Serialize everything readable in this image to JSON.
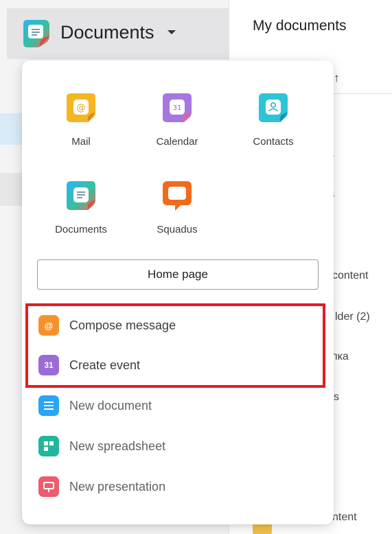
{
  "app_switcher": {
    "title": "Documents",
    "caret_icon": "chevron-down-icon",
    "icon": "documents-icon"
  },
  "main": {
    "title": "My documents",
    "sort_icon": "arrow-up-icon",
    "list_fragments": [
      "gh",
      "-",
      "ats",
      "content",
      "lder (2)",
      "апка",
      "s",
      "l",
      "ntent"
    ]
  },
  "menu": {
    "apps": [
      {
        "label": "Mail",
        "icon": "mail-icon"
      },
      {
        "label": "Calendar",
        "icon": "calendar-icon"
      },
      {
        "label": "Contacts",
        "icon": "contacts-icon"
      },
      {
        "label": "Documents",
        "icon": "documents-icon"
      },
      {
        "label": "Squadus",
        "icon": "squadus-icon"
      }
    ],
    "home_button": "Home page",
    "actions": [
      {
        "label": "Compose message",
        "icon": "at-icon",
        "glyph": "@",
        "color": "#f6922b"
      },
      {
        "label": "Create event",
        "icon": "calendar-31-icon",
        "glyph": "31",
        "color": "#9b6bd6"
      },
      {
        "label": "New document",
        "icon": "document-lines-icon",
        "color": "#2aa4f4"
      },
      {
        "label": "New spreadsheet",
        "icon": "spreadsheet-icon",
        "color": "#21b79c"
      },
      {
        "label": "New presentation",
        "icon": "presentation-icon",
        "color": "#ef5b6e"
      }
    ]
  },
  "colors": {
    "highlight_border": "#e51b24",
    "mail": "#f6c026",
    "calendar": "#a777e0",
    "contacts": "#2cc4d6",
    "documents": "#2aa4f4",
    "squadus": "#f26a1b"
  }
}
